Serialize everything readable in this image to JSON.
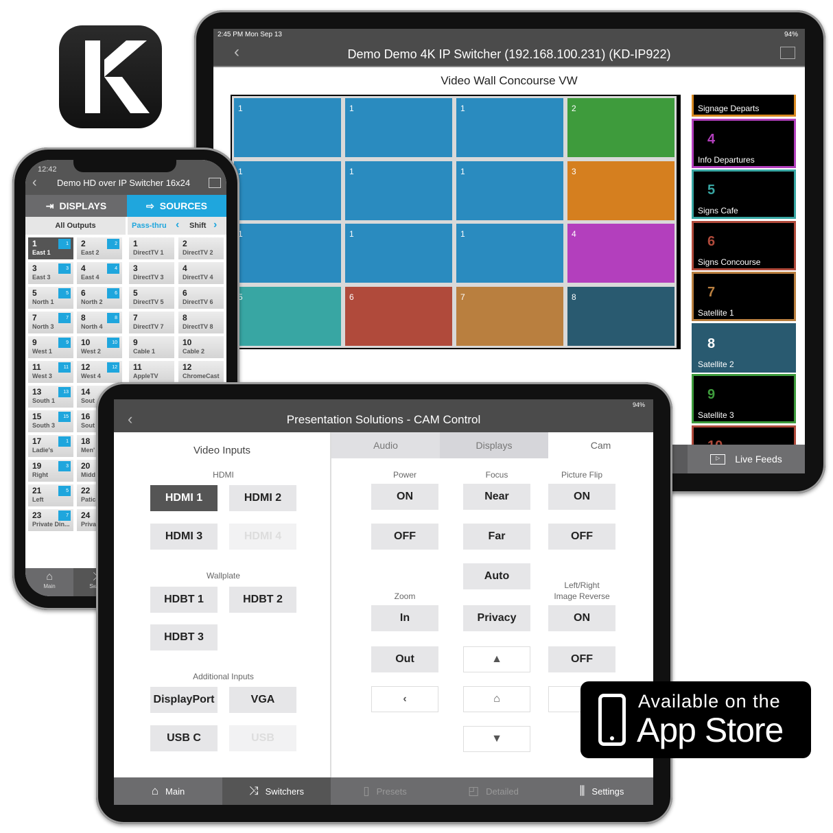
{
  "brand": {
    "logo_letter": "K"
  },
  "tablet_top": {
    "status_time": "2:45 PM  Mon Sep 13",
    "battery": "94%",
    "title": "Demo Demo 4K IP Switcher (192.168.100.231) (KD-IP922)",
    "wall_title": "Video Wall Concourse VW",
    "wall": [
      [
        "1",
        "1",
        "1",
        "2"
      ],
      [
        "1",
        "1",
        "1",
        "3"
      ],
      [
        "1",
        "1",
        "1",
        "4"
      ],
      [
        "5",
        "6",
        "7",
        "8"
      ]
    ],
    "colors": {
      "1": "#2a8bbf",
      "2": "#3e9b3c",
      "3": "#d57f1f",
      "4": "#b33fbd",
      "5": "#38a6a3",
      "6": "#b04a3b",
      "7": "#b97f3f",
      "8": "#295a70"
    },
    "sources": [
      {
        "num": "",
        "label": "Signage Departs",
        "color": "#d98a22"
      },
      {
        "num": "4",
        "label": "Info Departures",
        "color": "#b33fbd"
      },
      {
        "num": "5",
        "label": "Signs Cafe",
        "color": "#38a6a3"
      },
      {
        "num": "6",
        "label": "Signs Concourse",
        "color": "#b04a3b"
      },
      {
        "num": "7",
        "label": "Satellite 1",
        "color": "#b97f3f"
      },
      {
        "num": "8",
        "label": "Satellite 2",
        "color": "#295a70",
        "selected": true
      },
      {
        "num": "9",
        "label": "Satellite 3",
        "color": "#3e9b3c"
      },
      {
        "num": "10",
        "label": "",
        "color": "#b04a3b"
      }
    ],
    "live_feeds": "Live Feeds"
  },
  "phone": {
    "status_time": "12:42",
    "title": "Demo HD over IP Switcher 16x24",
    "tab_displays": "DISPLAYS",
    "tab_sources": "SOURCES",
    "all_outputs": "All Outputs",
    "pass_thru": "Pass-thru",
    "shift": "Shift",
    "displays": [
      {
        "n": "1",
        "name": "East 1",
        "badge": "1",
        "selected": true
      },
      {
        "n": "2",
        "name": "East 2",
        "badge": "2"
      },
      {
        "n": "3",
        "name": "East 3",
        "badge": "3"
      },
      {
        "n": "4",
        "name": "East 4",
        "badge": "4"
      },
      {
        "n": "5",
        "name": "North 1",
        "badge": "5"
      },
      {
        "n": "6",
        "name": "North 2",
        "badge": "6"
      },
      {
        "n": "7",
        "name": "North 3",
        "badge": "7"
      },
      {
        "n": "8",
        "name": "North 4",
        "badge": "8"
      },
      {
        "n": "9",
        "name": "West 1",
        "badge": "9"
      },
      {
        "n": "10",
        "name": "West 2",
        "badge": "10"
      },
      {
        "n": "11",
        "name": "West 3",
        "badge": "11"
      },
      {
        "n": "12",
        "name": "West 4",
        "badge": "12"
      },
      {
        "n": "13",
        "name": "South 1",
        "badge": "13"
      },
      {
        "n": "14",
        "name": "Sout"
      },
      {
        "n": "15",
        "name": "South 3",
        "badge": "15"
      },
      {
        "n": "16",
        "name": "Sout"
      },
      {
        "n": "17",
        "name": "Ladie's",
        "badge": "1"
      },
      {
        "n": "18",
        "name": "Men'"
      },
      {
        "n": "19",
        "name": "Right",
        "badge": "3"
      },
      {
        "n": "20",
        "name": "Midd"
      },
      {
        "n": "21",
        "name": "Left",
        "badge": "5"
      },
      {
        "n": "22",
        "name": "Patic"
      },
      {
        "n": "23",
        "name": "Private Din...",
        "badge": "7"
      },
      {
        "n": "24",
        "name": "Priva"
      }
    ],
    "sources": [
      {
        "n": "1",
        "name": "DirectTV 1"
      },
      {
        "n": "2",
        "name": "DirectTV 2"
      },
      {
        "n": "3",
        "name": "DirectTV 3"
      },
      {
        "n": "4",
        "name": "DirectTV 4"
      },
      {
        "n": "5",
        "name": "DirectTV 5"
      },
      {
        "n": "6",
        "name": "DirectTV 6"
      },
      {
        "n": "7",
        "name": "DirectTV 7"
      },
      {
        "n": "8",
        "name": "DirectTV 8"
      },
      {
        "n": "9",
        "name": "Cable 1"
      },
      {
        "n": "10",
        "name": "Cable 2"
      },
      {
        "n": "11",
        "name": "AppleTV"
      },
      {
        "n": "12",
        "name": "ChromeCast"
      }
    ],
    "nav_main": "Main",
    "nav_switch": "Switch"
  },
  "tablet_bottom": {
    "battery": "94%",
    "title": "Presentation Solutions - CAM Control",
    "left_title": "Video Inputs",
    "hdmi_label": "HDMI",
    "wallplate_label": "Wallplate",
    "additional_label": "Additional Inputs",
    "inputs": {
      "hdmi1": "HDMI 1",
      "hdmi2": "HDMI 2",
      "hdmi3": "HDMI 3",
      "hdmi4": "HDMI 4",
      "hdbt1": "HDBT 1",
      "hdbt2": "HDBT 2",
      "hdbt3": "HDBT 3",
      "dp": "DisplayPort",
      "vga": "VGA",
      "usbc": "USB C",
      "usb": "USB"
    },
    "tabs": [
      "Audio",
      "Displays",
      "Cam"
    ],
    "cam": {
      "power": "Power",
      "focus": "Focus",
      "flip": "Picture Flip",
      "zoom": "Zoom",
      "lr": "Left/Right",
      "lr2": "Image Reverse",
      "on": "ON",
      "off": "OFF",
      "near": "Near",
      "far": "Far",
      "auto": "Auto",
      "in": "In",
      "out": "Out",
      "privacy": "Privacy"
    },
    "toolbar": [
      "Main",
      "Switchers",
      "Presets",
      "Detailed",
      "Settings"
    ]
  },
  "badge": {
    "line1": "Available on the",
    "line2": "App Store"
  }
}
